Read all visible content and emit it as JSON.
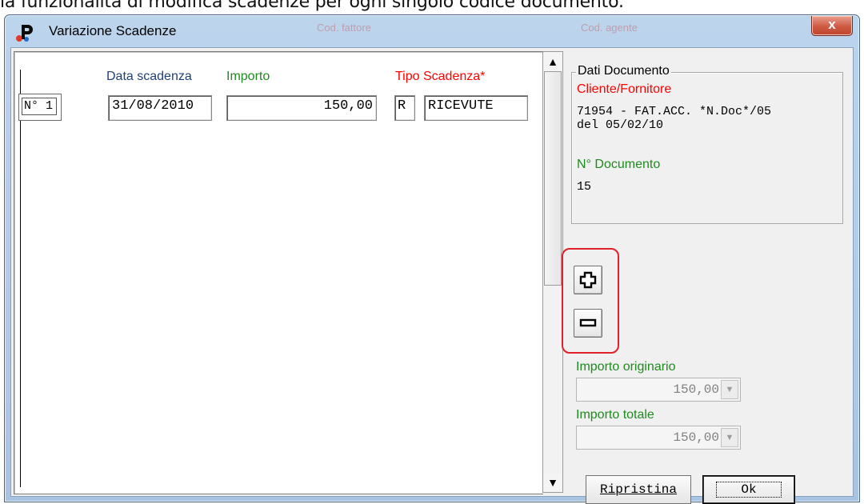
{
  "caption": "la funzionalità di modifica scadenze per ogni singolo codice documento.",
  "window": {
    "title": "Variazione Scadenze",
    "close_label": "x",
    "ghost_text_1": "Cod. fattore",
    "ghost_text_2": "Cod. agente"
  },
  "list": {
    "headers": {
      "data_scadenza": "Data scadenza",
      "importo": "Importo",
      "tipo_scadenza": "Tipo Scadenza*"
    },
    "rows": [
      {
        "number": "N° 1",
        "data": "31/08/2010",
        "importo": "150,00",
        "tipo_code": "R",
        "tipo_desc": "RICEVUTE"
      }
    ]
  },
  "document": {
    "group_title": "Dati Documento",
    "cliente_label": "Cliente/Fornitore",
    "cliente_line1": "71954 - FAT.ACC. *N.Doc*/05",
    "cliente_line2": "del 05/02/10",
    "num_doc_label": "N° Documento",
    "num_doc_value": "15"
  },
  "buttons": {
    "add_icon": "plus-icon",
    "remove_icon": "minus-icon",
    "ripristina_label": "Ripristina",
    "ok_label": "Ok"
  },
  "importo_originario": {
    "label": "Importo originario",
    "value": "150,00"
  },
  "importo_totale": {
    "label": "Importo totale",
    "value": "150,00"
  },
  "colors": {
    "header_blue": "#1f3f7a",
    "header_green": "#1f8a1f",
    "header_red": "#ff0000",
    "highlight_red": "#e0202a"
  }
}
